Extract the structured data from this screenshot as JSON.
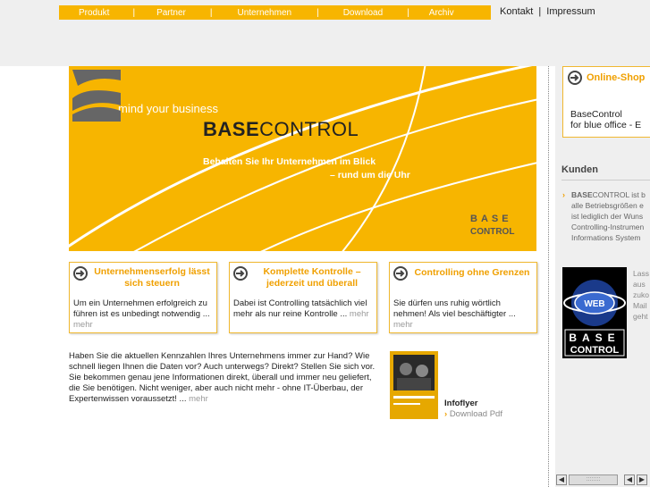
{
  "nav": {
    "items": [
      "Produkt",
      "Partner",
      "Unternehmen",
      "Download",
      "Archiv"
    ],
    "separator": "|"
  },
  "toplinks": {
    "kontakt": "Kontakt",
    "separator": "|",
    "impressum": "Impressum"
  },
  "hero": {
    "tagline": "mind your business",
    "brand_bold": "BASE",
    "brand_light": "CONTROL",
    "sub_line1": "Behalten Sie Ihr Unternehmen im Blick",
    "sub_line2": "– rund um die Uhr",
    "logo_line1": "BASE",
    "logo_line2": "CONTROL"
  },
  "boxes": [
    {
      "title": "Unternehmenserfolg lässt sich steuern",
      "body": "Um ein Unternehmen erfolgreich zu führen ist es unbedingt notwendig ...",
      "more": "mehr"
    },
    {
      "title": "Komplette Kontrolle – jederzeit und überall",
      "body": "Dabei ist Controlling tatsächlich viel mehr als nur reine Kontrolle ...",
      "more": "mehr"
    },
    {
      "title": "Controlling ohne Grenzen",
      "body": "Sie dürfen uns ruhig wörtlich nehmen! Als viel beschäftigter ...",
      "more": "mehr"
    }
  ],
  "main_text": {
    "body": "Haben Sie die aktuellen Kennzahlen Ihres Unternehmens immer zur Hand? Wie schnell liegen Ihnen die Daten vor? Auch unterwegs? Direkt? Stellen Sie sich vor. Sie bekommen genau jene Informationen direkt, überall und immer neu geliefert, die Sie benötigen. Nicht weniger, aber auch nicht mehr - ohne IT-Überbau, der Expertenwissen voraussetzt! ...",
    "more": "mehr"
  },
  "flyer": {
    "label": "Infoflyer",
    "link": "Download Pdf"
  },
  "sidebar": {
    "shop_title": "Online-Shop",
    "shop_line1": "BaseControl",
    "shop_line2": "for blue office - E",
    "kunden_title": "Kunden",
    "kunden_brand": "BASE",
    "kunden_lines": [
      "CONTROL ist b",
      "alle Betriebsgrößen e",
      "ist lediglich der Wuns",
      "Controlling-Instrumen",
      "Informations System"
    ],
    "web_label": "WEB",
    "web_logo_line1": "BASE",
    "web_logo_line2": "CONTROL",
    "web_lines": [
      "Lass",
      "aus",
      "zuko",
      "Mail",
      "geht"
    ]
  },
  "scrollbar": {
    "left": "◀",
    "thumb": "::::::::",
    "prev": "◀",
    "next": "▶"
  }
}
